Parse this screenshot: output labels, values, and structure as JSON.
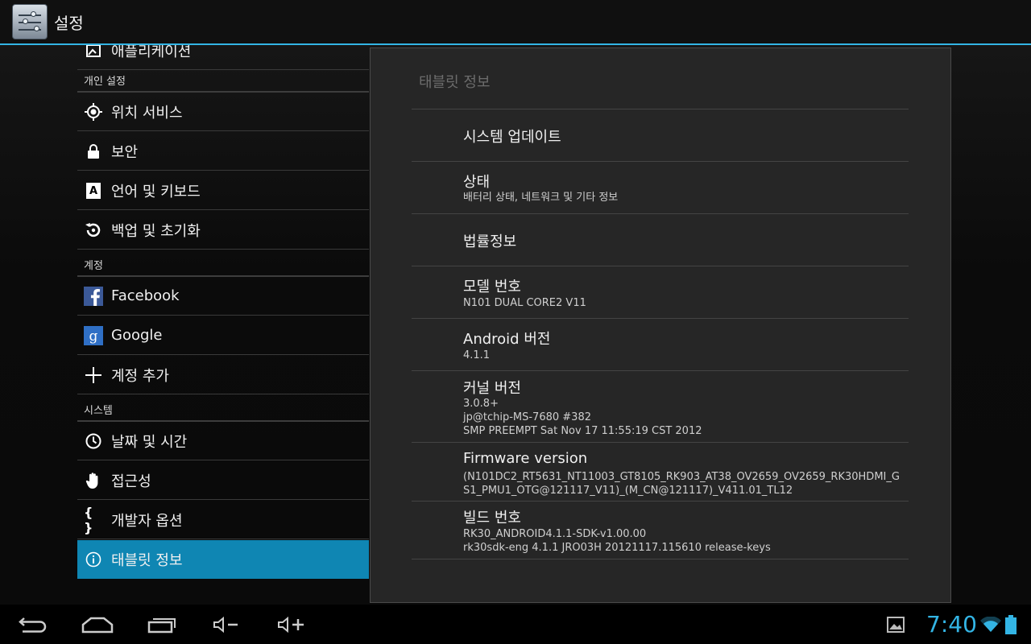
{
  "actionbar": {
    "title": "설정"
  },
  "left": {
    "partial_top_label": "애플리케이션",
    "section_personal": "개인 설정",
    "location": "위치 서비스",
    "security": "보안",
    "language": "언어 및 키보드",
    "backup": "백업 및 초기화",
    "section_accounts": "계정",
    "facebook": "Facebook",
    "google": "Google",
    "add_account": "계정 추가",
    "section_system": "시스템",
    "datetime": "날짜 및 시간",
    "accessibility": "접근성",
    "developer": "개발자 옵션",
    "about": "태블릿 정보"
  },
  "panel": {
    "title": "태블릿 정보",
    "system_update": "시스템 업데이트",
    "status_title": "상태",
    "status_sub": "배터리 상태, 네트워크 및 기타 정보",
    "legal": "법률정보",
    "model_title": "모델 번호",
    "model_value": "N101 DUAL CORE2 V11",
    "android_title": "Android 버전",
    "android_value": "4.1.1",
    "kernel_title": "커널 버전",
    "kernel_value": "3.0.8+\njp@tchip-MS-7680 #382\nSMP PREEMPT Sat Nov 17 11:55:19 CST 2012",
    "firmware_title": "Firmware version",
    "firmware_value": "(N101DC2_RT5631_NT11003_GT8105_RK903_AT38_OV2659_OV2659_RK30HDMI_G\nS1_PMU1_OTG@121117_V11)_(M_CN@121117)_V411.01_TL12",
    "build_title": "빌드 번호",
    "build_value": "RK30_ANDROID4.1.1-SDK-v1.00.00\nrk30sdk-eng 4.1.1 JRO03H 20121117.115610 release-keys"
  },
  "status": {
    "time": "7:40"
  },
  "colors": {
    "accent": "#33b5e5",
    "selected": "#0f86b3"
  },
  "icons": {
    "back": "back-icon",
    "home": "home-icon",
    "recents": "recents-icon",
    "vol_down": "volume-down-icon",
    "vol_up": "volume-up-icon",
    "gallery": "image-icon",
    "wifi": "wifi-icon",
    "battery": "battery-icon"
  }
}
